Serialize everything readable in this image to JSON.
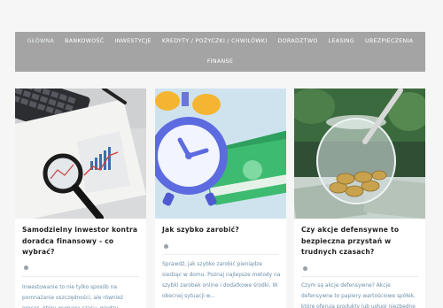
{
  "nav": {
    "row1": [
      "Główna",
      "Bankowość",
      "Inwestycje",
      "Kredyty / Pożyczki / Chwilówki",
      "Doradztwo",
      "Leasing",
      "Ubezpieczenia"
    ],
    "row2": [
      "Finanse"
    ]
  },
  "cards": [
    {
      "title": "Samodzielny inwestor kontra doradca finansowy - co wybrać?",
      "excerpt": "Inwestowanie to nie tylko sposób na pomnażanie oszczędności, ale również proces, który wymaga czasu, wiedzy"
    },
    {
      "title": "Jak szybko zarobić?",
      "excerpt": "Sprawdź, jak szybko zarobić pieniądze siedząc w domu. Poznaj najlepsze metody na szybki zarobek online i dodatkowe środki. W obecnej sytuacji w..."
    },
    {
      "title": "Czy akcje defensywne to bezpieczna przystań w trudnych czasach?",
      "excerpt": "Czym są akcje defensywne? Akcje defensywne to papiery wartościowe spółek, które oferują produkty lub usługi niezbędne"
    }
  ],
  "icons": {
    "card_image_1": "magnifier-chart-image",
    "card_image_2": "alarm-clock-money-image",
    "card_image_3": "coin-jar-image"
  }
}
